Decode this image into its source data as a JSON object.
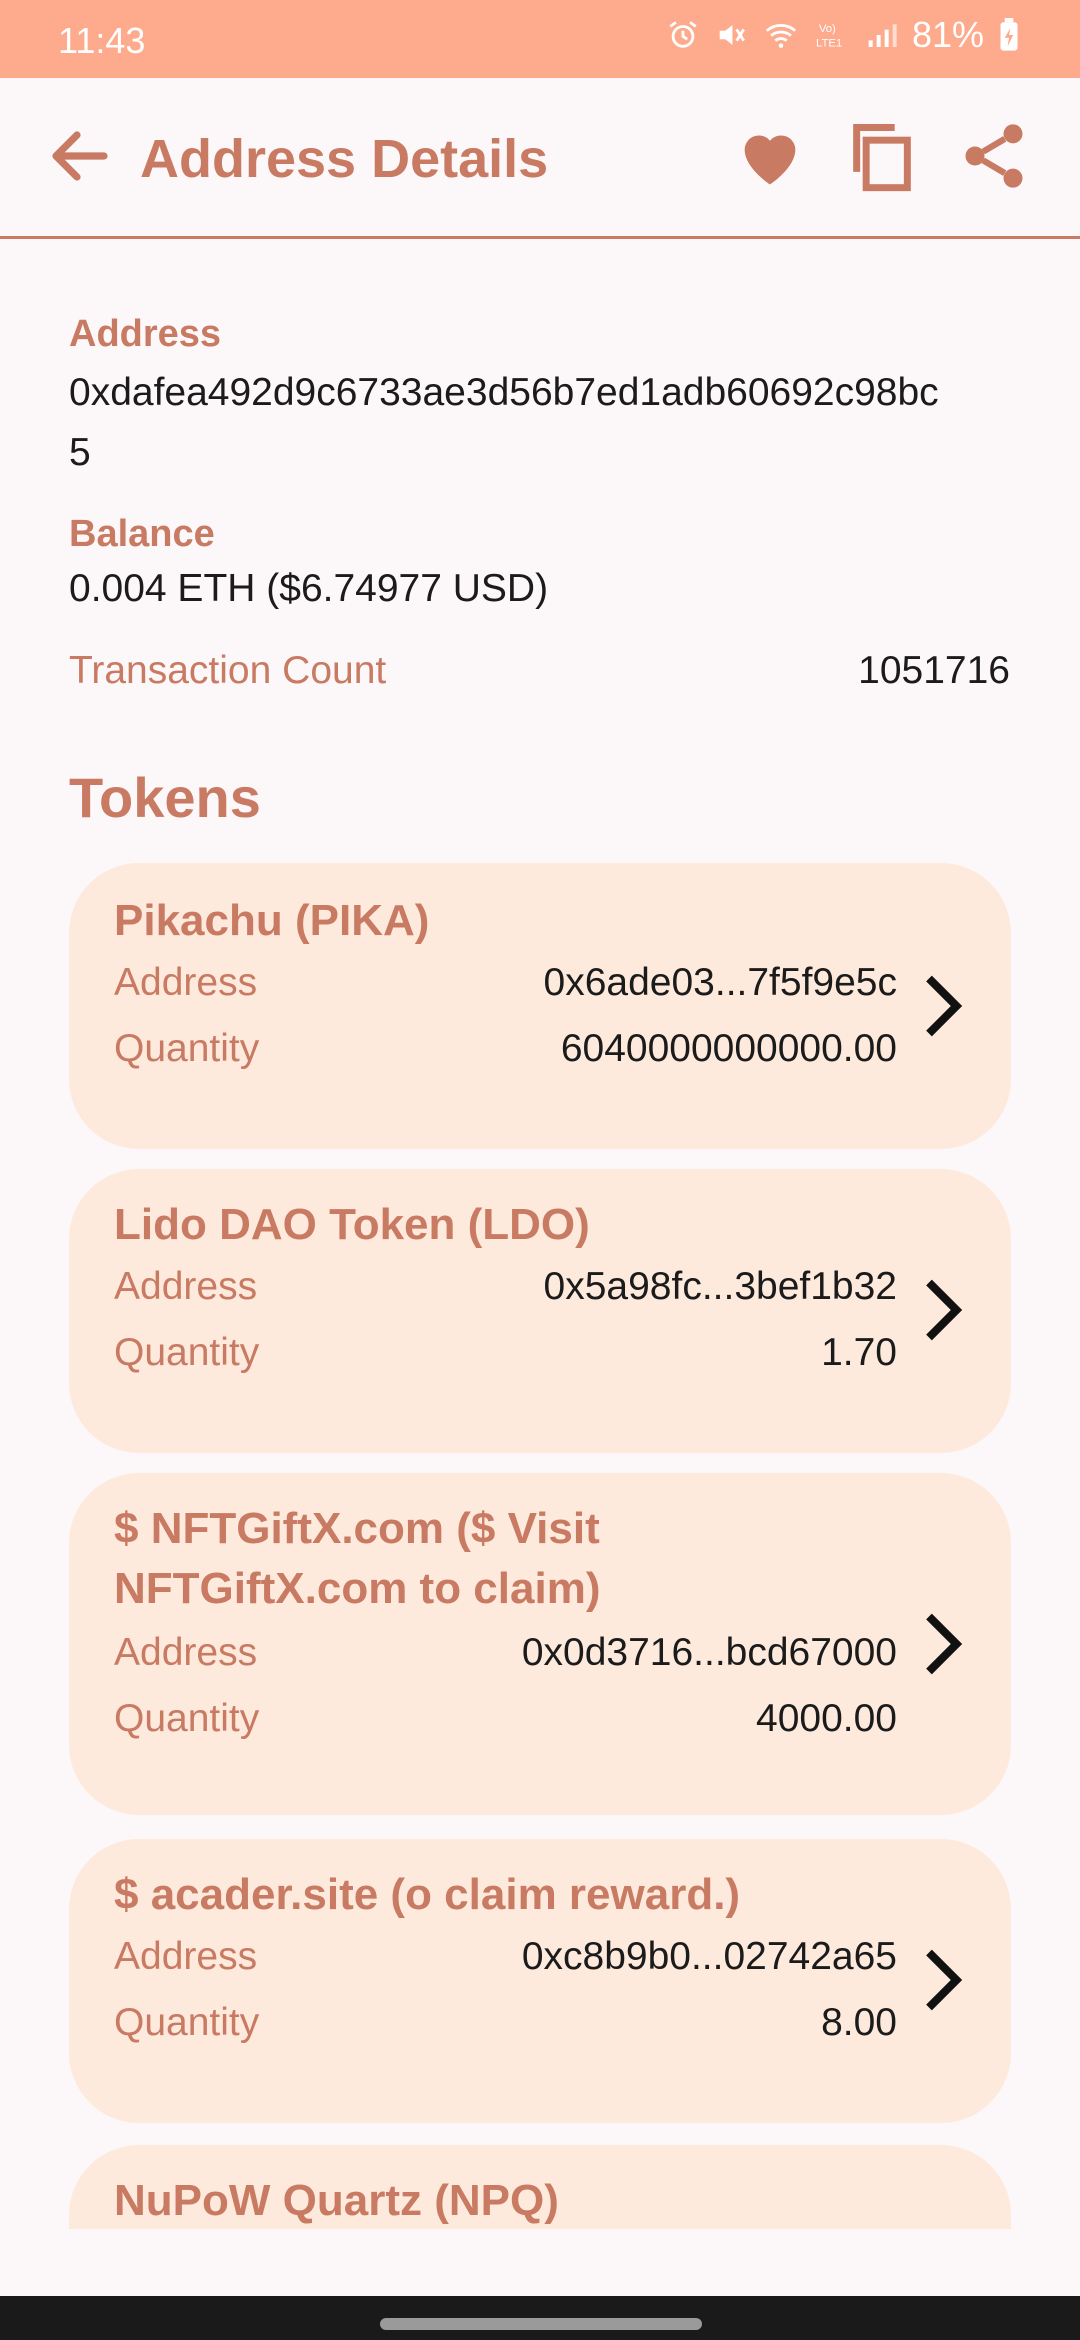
{
  "status_bar": {
    "time": "11:43",
    "battery": "81%",
    "icons": [
      "alarm-icon",
      "mute-icon",
      "wifi-icon",
      "volte-icon",
      "signal-icon",
      "battery-charging-icon"
    ]
  },
  "app_bar": {
    "title": "Address Details",
    "actions": [
      "favorite-icon",
      "copy-icon",
      "share-icon"
    ]
  },
  "address": {
    "label": "Address",
    "value_line1": "0xdafea492d9c6733ae3d56b7ed1adb60692c98bc",
    "value_line2": "5"
  },
  "balance": {
    "label": "Balance",
    "value": "0.004 ETH ($6.74977 USD)"
  },
  "transaction_count": {
    "label": "Transaction Count",
    "value": "1051716"
  },
  "tokens": {
    "title": "Tokens",
    "address_label": "Address",
    "quantity_label": "Quantity",
    "items": [
      {
        "name_line1": "Pikachu (PIKA)",
        "name_line2": "",
        "address": "0x6ade03...7f5f9e5c",
        "quantity": "6040000000000.00"
      },
      {
        "name_line1": "Lido DAO Token (LDO)",
        "name_line2": "",
        "address": "0x5a98fc...3bef1b32",
        "quantity": "1.70"
      },
      {
        "name_line1": "$ NFTGiftX.com ($ Visit",
        "name_line2": "NFTGiftX.com to claim)",
        "address": "0x0d3716...bcd67000",
        "quantity": "4000.00"
      },
      {
        "name_line1": "$ acader.site (o claim reward.)",
        "name_line2": "",
        "address": "0xc8b9b0...02742a65",
        "quantity": "8.00"
      },
      {
        "name_line1": "NuPoW Quartz (NPQ)"
      }
    ]
  },
  "colors": {
    "accent": "#c87a62",
    "status_bar": "#fdaa8d",
    "card": "#fdeadd",
    "background": "#fcf7f9"
  }
}
